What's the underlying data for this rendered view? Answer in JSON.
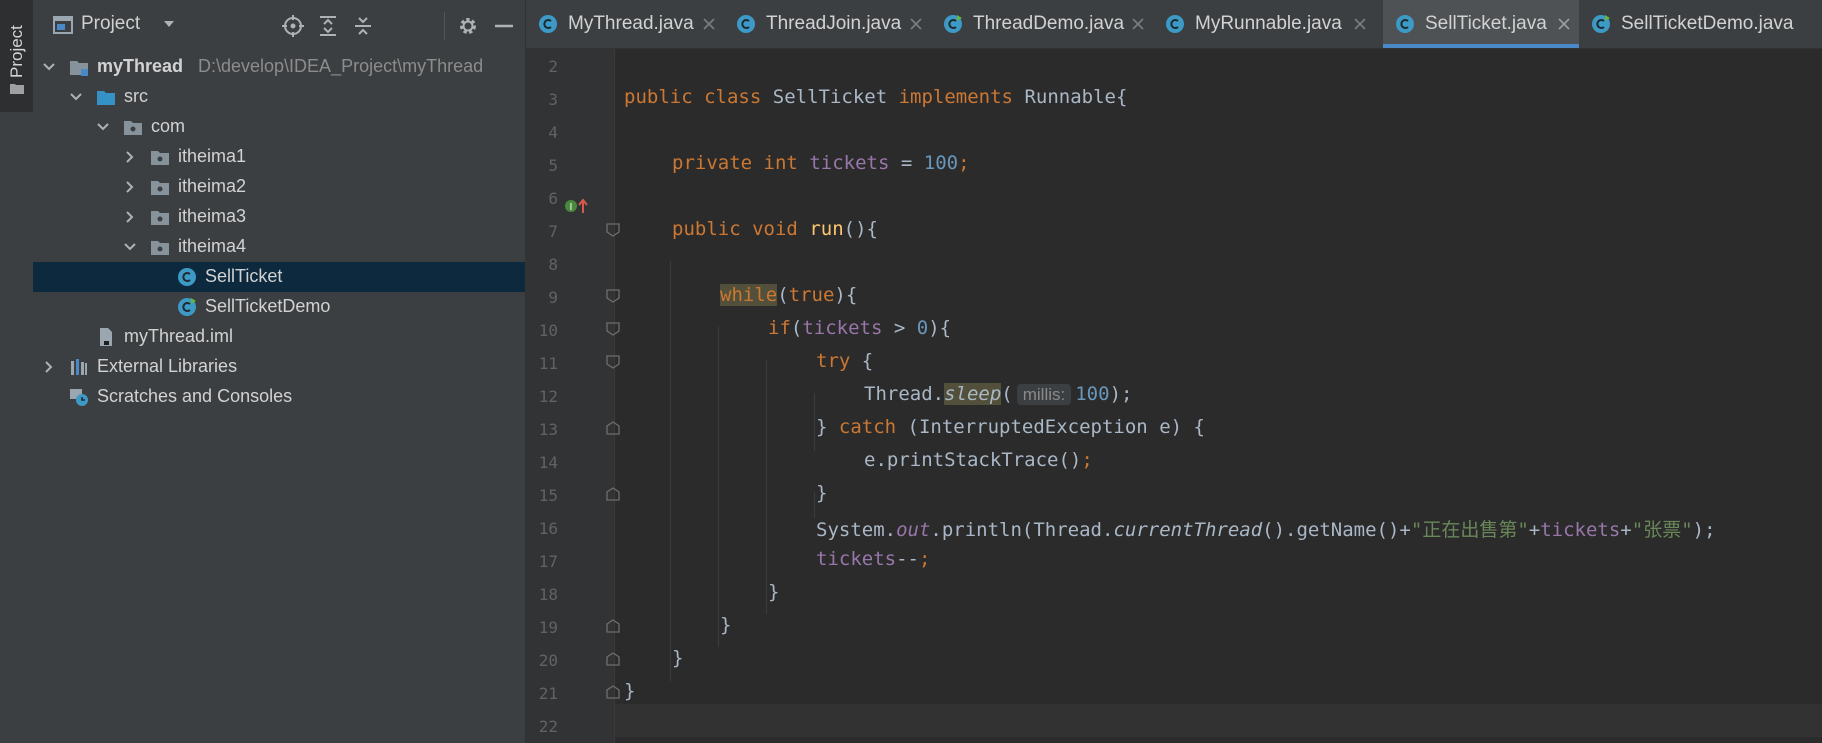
{
  "sidebar_stripe": {
    "label": "Project"
  },
  "project_panel": {
    "title": "Project",
    "tree": [
      {
        "label": "myThread",
        "path": "D:\\develop\\IDEA_Project\\myThread",
        "bold": true
      },
      {
        "label": "src"
      },
      {
        "label": "com"
      },
      {
        "label": "itheima1"
      },
      {
        "label": "itheima2"
      },
      {
        "label": "itheima3"
      },
      {
        "label": "itheima4"
      },
      {
        "label": "SellTicket",
        "selected": true
      },
      {
        "label": "SellTicketDemo"
      },
      {
        "label": "myThread.iml"
      },
      {
        "label": "External Libraries"
      },
      {
        "label": "Scratches and Consoles"
      }
    ]
  },
  "tabs": [
    {
      "label": "MyThread.java"
    },
    {
      "label": "ThreadJoin.java"
    },
    {
      "label": "ThreadDemo.java"
    },
    {
      "label": "MyRunnable.java"
    },
    {
      "label": "SellTicket.java",
      "active": true
    },
    {
      "label": "SellTicketDemo.java"
    }
  ],
  "editor": {
    "line_numbers": [
      "2",
      "3",
      "4",
      "5",
      "6",
      "7",
      "8",
      "9",
      "10",
      "11",
      "12",
      "13",
      "14",
      "15",
      "16",
      "17",
      "18",
      "19",
      "20",
      "21",
      "22"
    ],
    "code": {
      "l3": [
        "public",
        "class",
        "SellTicket",
        "implements",
        "Runnable{"
      ],
      "l5": [
        "private",
        "int",
        "tickets",
        "=",
        "100",
        ";"
      ],
      "l7": [
        "public",
        "void",
        "run",
        "(){"
      ],
      "l9": [
        "while",
        "(",
        "true",
        "){"
      ],
      "l10": [
        "if",
        "(",
        "tickets",
        " > ",
        "0",
        "){"
      ],
      "l11": [
        "try",
        " {"
      ],
      "l12": [
        "Thread.",
        "sleep",
        "(",
        "millis:",
        "100",
        ");"
      ],
      "l13": [
        "} ",
        "catch",
        " (InterruptedException e) {"
      ],
      "l14": [
        "e.printStackTrace()",
        ";"
      ],
      "l15": [
        "}"
      ],
      "l16": [
        "System.",
        "out",
        ".println(Thread.",
        "currentThread",
        "().getName()+",
        "\"正在出售第\"",
        "+",
        "tickets",
        "+",
        "\"张票\"",
        ");"
      ],
      "l17": [
        "tickets",
        "--",
        ";"
      ],
      "l18": [
        "}"
      ],
      "l19": [
        "}"
      ],
      "l20": [
        "}"
      ],
      "l21": [
        "}"
      ]
    }
  },
  "colors": {
    "keyword": "#cc7832",
    "field": "#9876aa",
    "number": "#6897bb",
    "string": "#6a8759",
    "method": "#ffc66d",
    "text": "#a9b7c6",
    "accent": "#4a88c7"
  }
}
